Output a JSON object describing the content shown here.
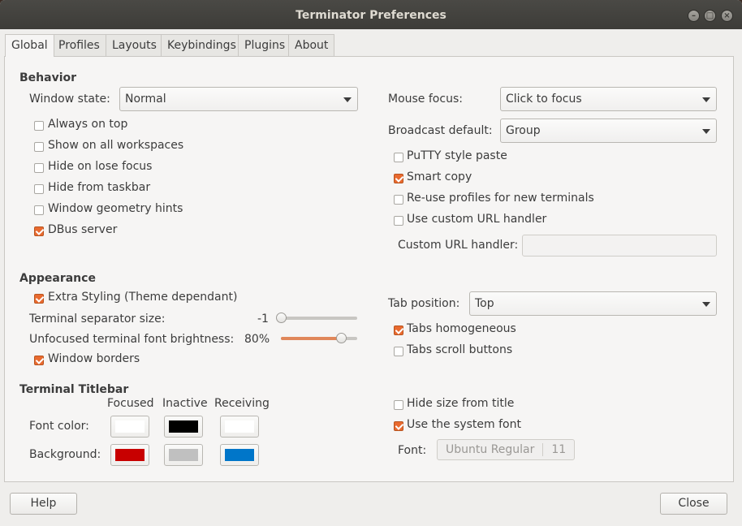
{
  "window": {
    "title": "Terminator Preferences"
  },
  "tabs": [
    "Global",
    "Profiles",
    "Layouts",
    "Keybindings",
    "Plugins",
    "About"
  ],
  "behavior": {
    "heading": "Behavior",
    "window_state_label": "Window state:",
    "window_state_value": "Normal",
    "options": [
      {
        "label": "Always on top",
        "checked": false
      },
      {
        "label": "Show on all workspaces",
        "checked": false
      },
      {
        "label": "Hide on lose focus",
        "checked": false
      },
      {
        "label": "Hide from taskbar",
        "checked": false
      },
      {
        "label": "Window geometry hints",
        "checked": false
      },
      {
        "label": "DBus server",
        "checked": true
      }
    ],
    "mouse_focus_label": "Mouse focus:",
    "mouse_focus_value": "Click to focus",
    "broadcast_label": "Broadcast default:",
    "broadcast_value": "Group",
    "right_options": [
      {
        "label": "PuTTY style paste",
        "checked": false
      },
      {
        "label": "Smart copy",
        "checked": true
      },
      {
        "label": "Re-use profiles for new terminals",
        "checked": false
      },
      {
        "label": "Use custom URL handler",
        "checked": false
      }
    ],
    "custom_url_label": "Custom URL handler:",
    "custom_url_value": ""
  },
  "appearance": {
    "heading": "Appearance",
    "extra_styling_label": "Extra Styling (Theme dependant)",
    "extra_styling_checked": true,
    "separator_label": "Terminal separator size:",
    "separator_value": "-1",
    "separator_level": 0,
    "brightness_label": "Unfocused terminal font brightness:",
    "brightness_value": "80%",
    "brightness_level": 0.8,
    "window_borders_label": "Window borders",
    "window_borders_checked": true,
    "tab_position_label": "Tab position:",
    "tab_position_value": "Top",
    "tabs_homogeneous_label": "Tabs homogeneous",
    "tabs_homogeneous_checked": true,
    "tabs_scroll_label": "Tabs scroll buttons",
    "tabs_scroll_checked": false
  },
  "titlebar": {
    "heading": "Terminal Titlebar",
    "col_focused": "Focused",
    "col_inactive": "Inactive",
    "col_receiving": "Receiving",
    "font_color_label": "Font color:",
    "background_label": "Background:",
    "font_colors": [
      "#ffffff",
      "#000000",
      "#ffffff"
    ],
    "background_colors": [
      "#c80000",
      "#c0c0c0",
      "#0076c9"
    ],
    "hide_size_label": "Hide size from title",
    "hide_size_checked": false,
    "system_font_label": "Use the system font",
    "system_font_checked": true,
    "font_label": "Font:",
    "font_name": "Ubuntu Regular",
    "font_size": "11"
  },
  "footer": {
    "help_label": "Help",
    "close_label": "Close"
  },
  "colors": {
    "accent": "#e96a2f",
    "titlebar": "#3d3c38"
  }
}
